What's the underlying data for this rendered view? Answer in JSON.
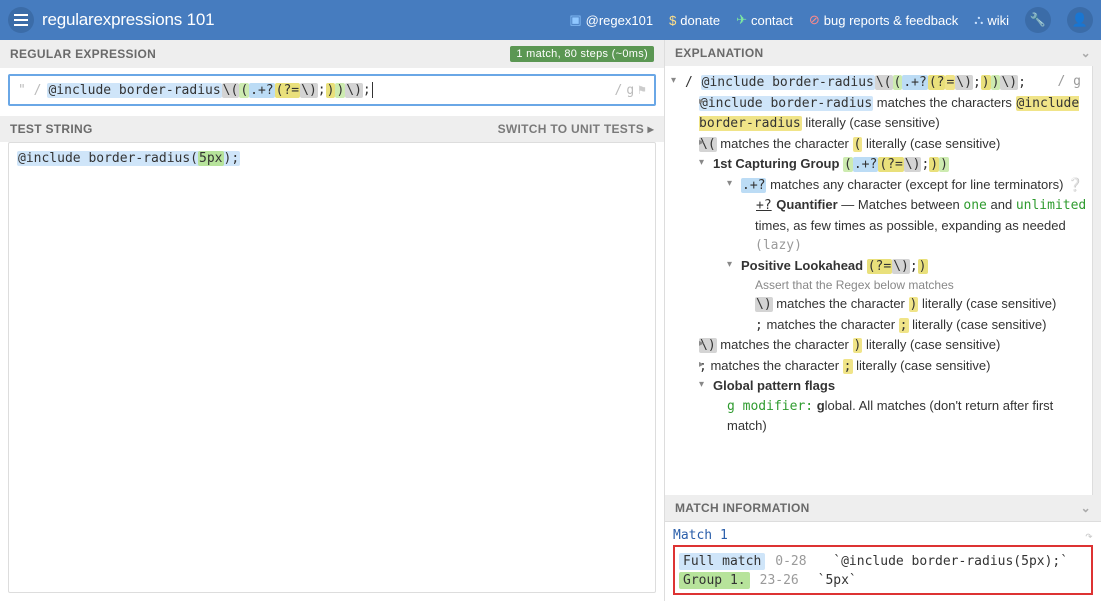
{
  "header": {
    "logo_plain": "regular",
    "logo_bold": "expressions",
    "logo_suffix": " 101",
    "links": {
      "twitter": "@regex101",
      "donate": "donate",
      "contact": "contact",
      "bugs": "bug reports & feedback",
      "wiki": "wiki"
    }
  },
  "regex": {
    "header": "REGULAR EXPRESSION",
    "status": "1 match, 80 steps (~0ms)",
    "delim_left": "\" /",
    "flags": "g",
    "tokens": {
      "t0": "@include border-radius",
      "t1": "\\(",
      "t2": "(",
      "t3": ".+?",
      "t4": "(?=",
      "t5": "\\)",
      "t6": ";",
      "t7": ")",
      "t8": ")",
      "t9": "\\)",
      "t10": ";"
    }
  },
  "test": {
    "header": "TEST STRING",
    "switch": "SWITCH TO UNIT TESTS ▸",
    "line_pre": "@include border-radius(",
    "line_grp": "5px",
    "line_post": ");"
  },
  "explanation": {
    "header": "EXPLANATION",
    "flags_label": "/ g",
    "echo": {
      "p0": "/ ",
      "p1": "@include border-radius",
      "p2": "\\(",
      "p3": "(",
      "p4": ".+?",
      "p5": "(?",
      "p6": "=",
      "p7": "\\)",
      "p8": ";",
      "p9": ")",
      "p10": ")",
      "p11": "\\)",
      "p12": ";"
    },
    "l1_a": "@include border-radius",
    "l1_b": " matches the characters ",
    "l1_c": "@include border-radius",
    "l1_d": " literally (case sensitive)",
    "l2_a": "\\(",
    "l2_b": " matches the character ",
    "l2_c": "(",
    "l2_d": " literally (case sensitive)",
    "cap_label": "1st Capturing Group ",
    "cap_code_a": "(",
    "cap_code_b": ".+?",
    "cap_code_c": "(?=",
    "cap_code_d": "\\)",
    "cap_code_e": ";",
    "cap_code_f": ")",
    "cap_code_g": ")",
    "dot_a": ".+?",
    "dot_b": " matches any character (except for line terminators) ",
    "q_a": "+?",
    "q_b": " Quantifier",
    "q_c": " — Matches between ",
    "q_one": "one",
    "q_and": " and ",
    "q_unl": "unlimited",
    "q_d": " times, as few times as possible, expanding as needed ",
    "q_lazy": "(lazy)",
    "la_label": "Positive Lookahead ",
    "la_a": "(?=",
    "la_b": "\\)",
    "la_c": ";",
    "la_d": ")",
    "la_note": "Assert that the Regex below matches",
    "la_l1a": "\\)",
    "la_l1b": " matches the character ",
    "la_l1c": ")",
    "la_l1d": " literally (case sensitive)",
    "la_l2a": ";",
    "la_l2b": " matches the character ",
    "la_l2c": ";",
    "la_l2d": " literally (case sensitive)",
    "post_a": "\\)",
    "post_b": " matches the character ",
    "post_c": ")",
    "post_d": " literally (case sensitive)",
    "semi_a": ";",
    "semi_b": " matches the character ",
    "semi_c": ";",
    "semi_d": " literally (case sensitive)",
    "gpf": "Global pattern flags",
    "gpf_a": "g modifier:",
    "gpf_b": " g",
    "gpf_c": "lobal. All matches (don't return after first match)"
  },
  "matchinfo": {
    "header": "MATCH INFORMATION",
    "m1": "Match 1",
    "full_label": "Full match",
    "full_range": "0-28",
    "full_text": "`@include border-radius(5px);`",
    "g1_label": "Group 1.",
    "g1_range": "23-26",
    "g1_text": "`5px`"
  }
}
